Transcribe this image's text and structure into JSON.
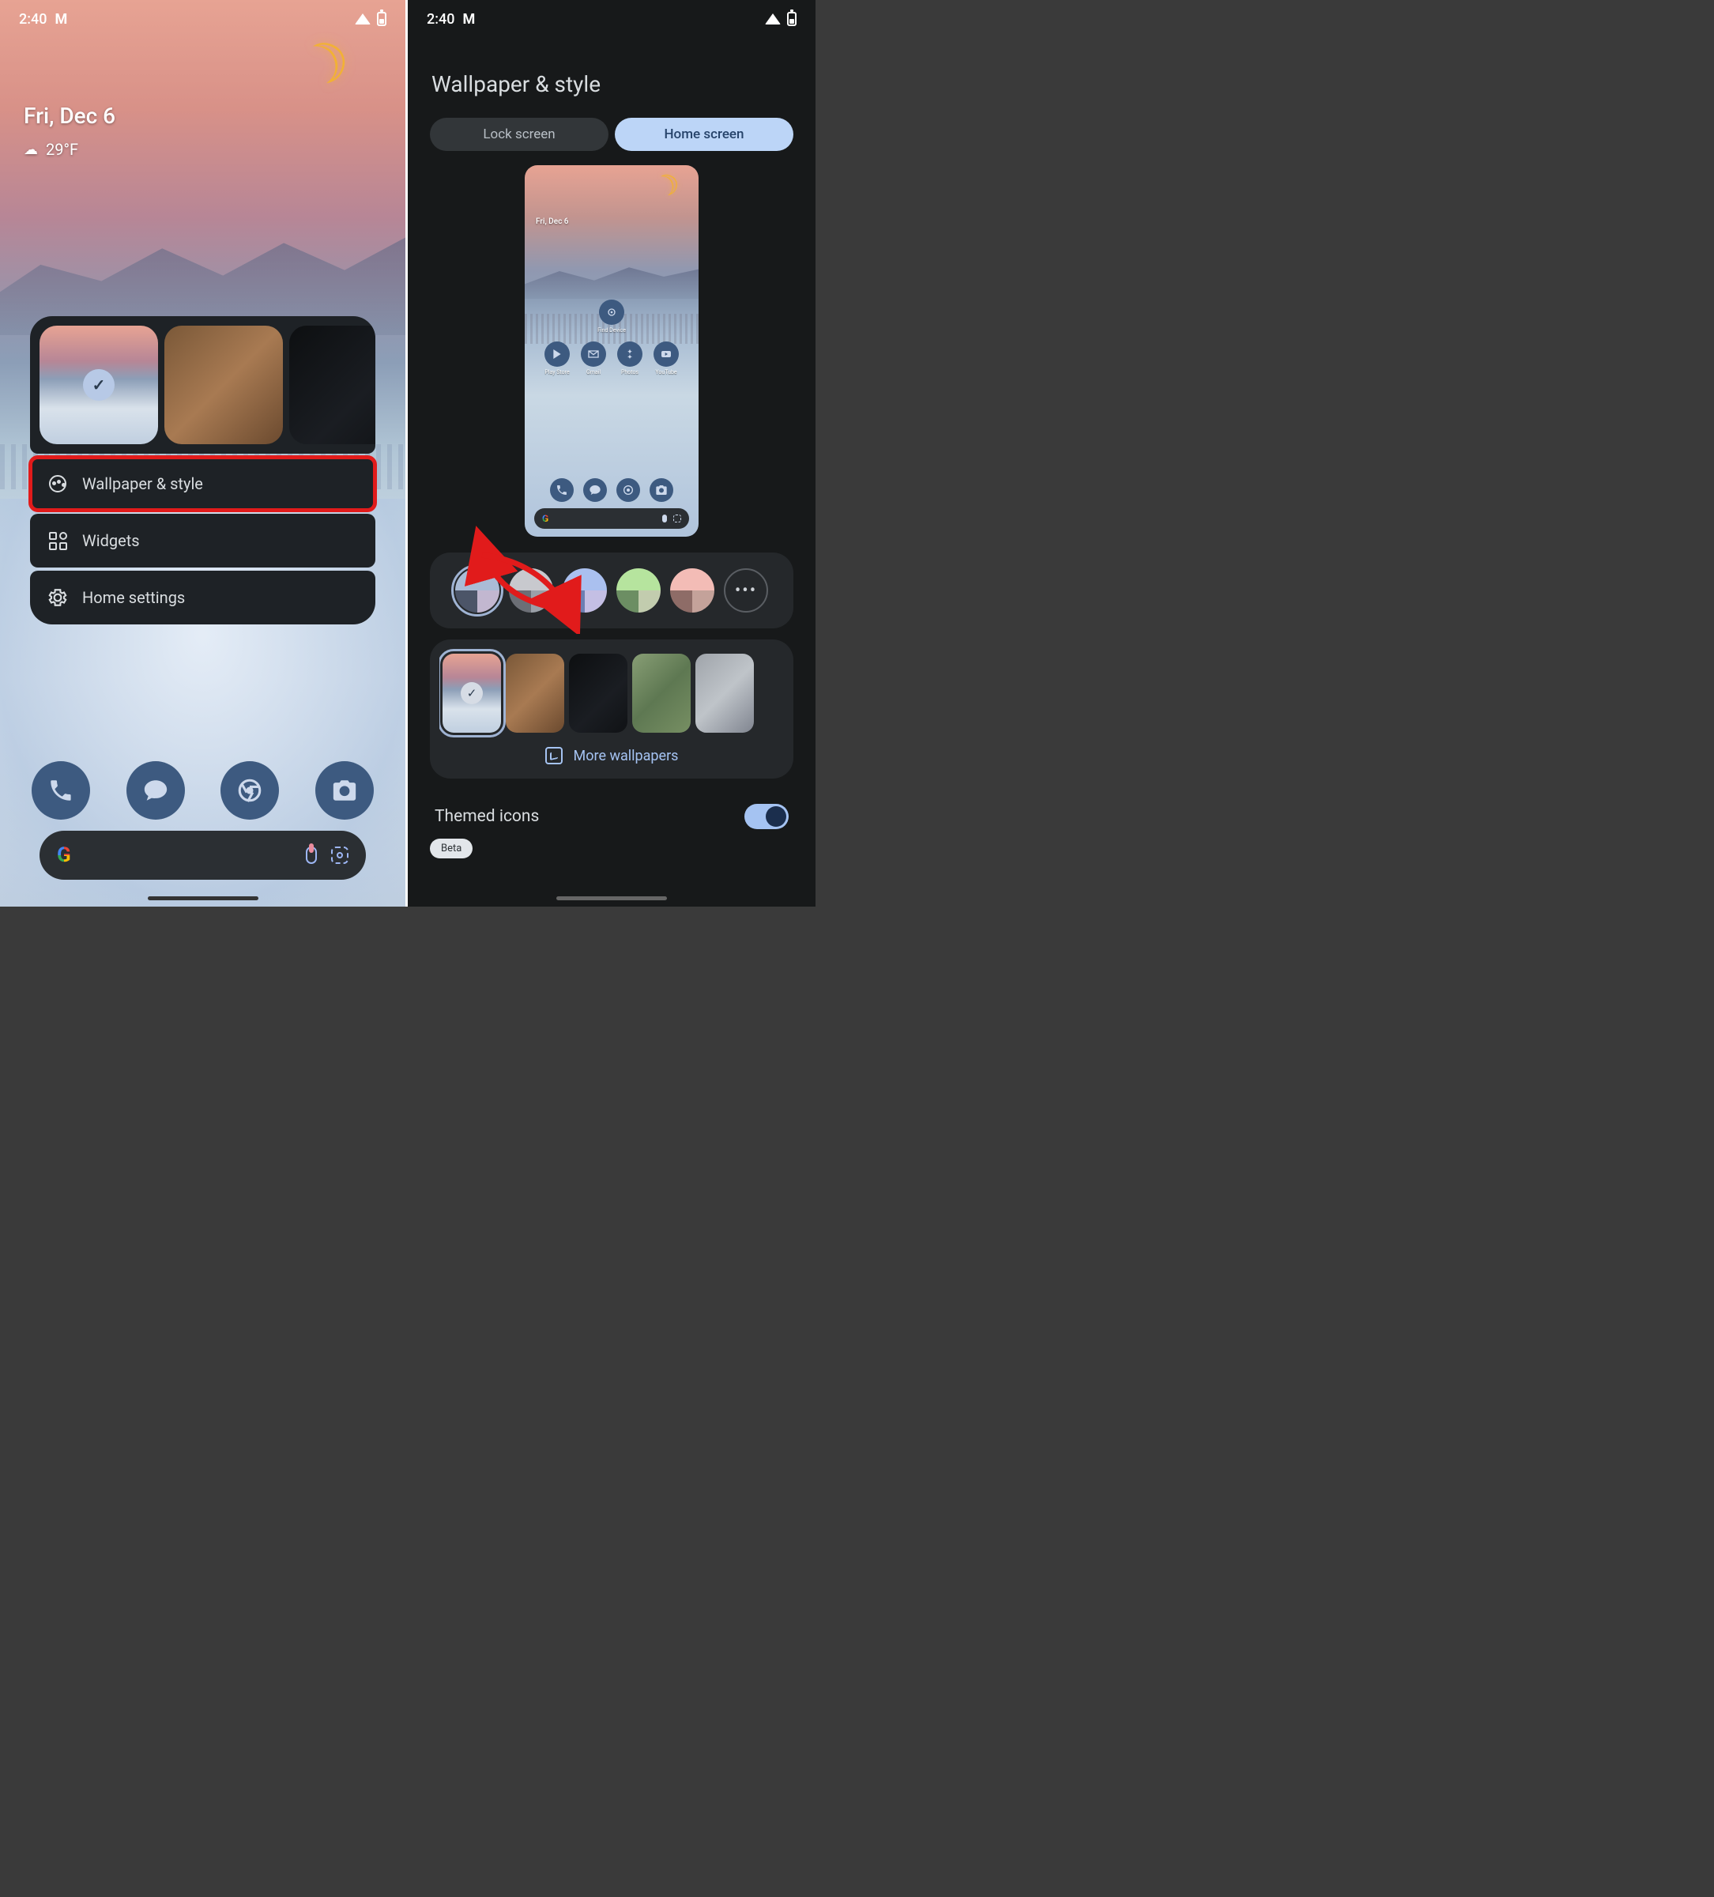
{
  "status_bar": {
    "time": "2:40"
  },
  "home": {
    "date": "Fri, Dec 6",
    "temperature": "29°F"
  },
  "popup": {
    "wallpaper_style_label": "Wallpaper & style",
    "widgets_label": "Widgets",
    "home_settings_label": "Home settings"
  },
  "right": {
    "title": "Wallpaper & style",
    "tabs": {
      "lock": "Lock screen",
      "home": "Home screen"
    },
    "preview": {
      "date": "Fri, Dec 6",
      "apps": {
        "find_device": "Find Device",
        "play_store": "Play Store",
        "gmail": "Gmail",
        "photos": "Photos",
        "youtube": "YouTube"
      }
    },
    "color_swatches": [
      {
        "top": "#aabcd6",
        "bl": "#4c5568",
        "br": "#c2b7d0",
        "selected": true
      },
      {
        "top": "#c8c9ce",
        "bl": "#6c6f76",
        "br": "#9aa0a8",
        "selected": false
      },
      {
        "top": "#aac0ef",
        "bl": "#6c7fb2",
        "br": "#c4bfe4",
        "selected": false
      },
      {
        "top": "#b6e49e",
        "bl": "#6c8e63",
        "br": "#c2ccae",
        "selected": false
      },
      {
        "top": "#f3bcb6",
        "bl": "#8e6c67",
        "br": "#c4a29a",
        "selected": false
      }
    ],
    "more_label": "•••",
    "more_wallpapers": "More wallpapers",
    "themed_icons_label": "Themed icons",
    "beta_label": "Beta"
  }
}
